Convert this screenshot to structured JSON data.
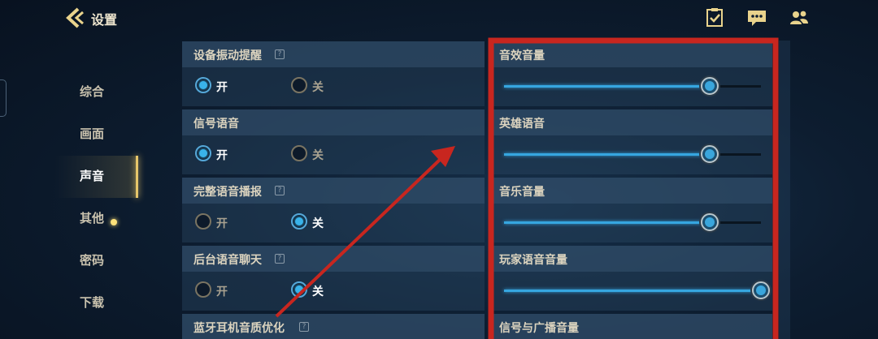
{
  "header": {
    "title": "设置"
  },
  "top_icons": [
    "task-list-icon",
    "chat-bubble-icon",
    "friends-icon"
  ],
  "nav": {
    "items": [
      {
        "label": "综合",
        "active": false
      },
      {
        "label": "画面",
        "active": false
      },
      {
        "label": "声音",
        "active": true
      },
      {
        "label": "其他",
        "active": false
      },
      {
        "label": "密码",
        "active": false
      },
      {
        "label": "下载",
        "active": false,
        "notification_dot": true
      }
    ]
  },
  "toggles": [
    {
      "label": "设备振动提醒",
      "help": "?",
      "on_label": "开",
      "off_label": "关",
      "value": "开"
    },
    {
      "label": "信号语音",
      "help": "",
      "on_label": "开",
      "off_label": "关",
      "value": "开"
    },
    {
      "label": "完整语音播报",
      "help": "?",
      "on_label": "开",
      "off_label": "关",
      "value": "关"
    },
    {
      "label": "后台语音聊天",
      "help": "?",
      "on_label": "开",
      "off_label": "关",
      "value": "关"
    },
    {
      "label": "蓝牙耳机音质优化",
      "help": "?"
    }
  ],
  "volumes": [
    {
      "label": "音效音量",
      "level": 0.8
    },
    {
      "label": "英雄语音",
      "level": 0.8
    },
    {
      "label": "音乐音量",
      "level": 0.8
    },
    {
      "label": "玩家语音音量",
      "level": 1.0
    },
    {
      "label": "信号与广播音量"
    }
  ],
  "colors": {
    "accent": "#39b3ea",
    "active_nav": "#e6c66a",
    "annotation": "#c8261f",
    "background": "#0d1d30"
  }
}
